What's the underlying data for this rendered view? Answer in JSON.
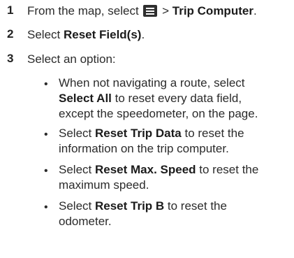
{
  "steps": [
    {
      "number": "1",
      "parts": {
        "prefix": "From the map, select ",
        "sep": " > ",
        "bold": "Trip Computer",
        "suffix": "."
      },
      "icon": "menu-icon"
    },
    {
      "number": "2",
      "parts": {
        "prefix": "Select ",
        "bold": "Reset Field(s)",
        "suffix": "."
      }
    },
    {
      "number": "3",
      "text": "Select an option:"
    }
  ],
  "bullets": [
    {
      "symbol": "•",
      "line1_pre": "When not navigating a route, select",
      "bold": "Select All",
      "line2_post": " to reset every data field,",
      "line3": "except the speedometer, on the page."
    },
    {
      "symbol": "•",
      "pre": "Select ",
      "bold": "Reset Trip Data",
      "post": " to reset the",
      "line2": "information on the trip computer."
    },
    {
      "symbol": "•",
      "pre": "Select ",
      "bold": "Reset Max. Speed",
      "post": " to reset the",
      "line2": "maximum speed."
    },
    {
      "symbol": "•",
      "pre": "Select ",
      "bold": "Reset Trip B",
      "post": " to reset the",
      "line2": "odometer."
    }
  ]
}
